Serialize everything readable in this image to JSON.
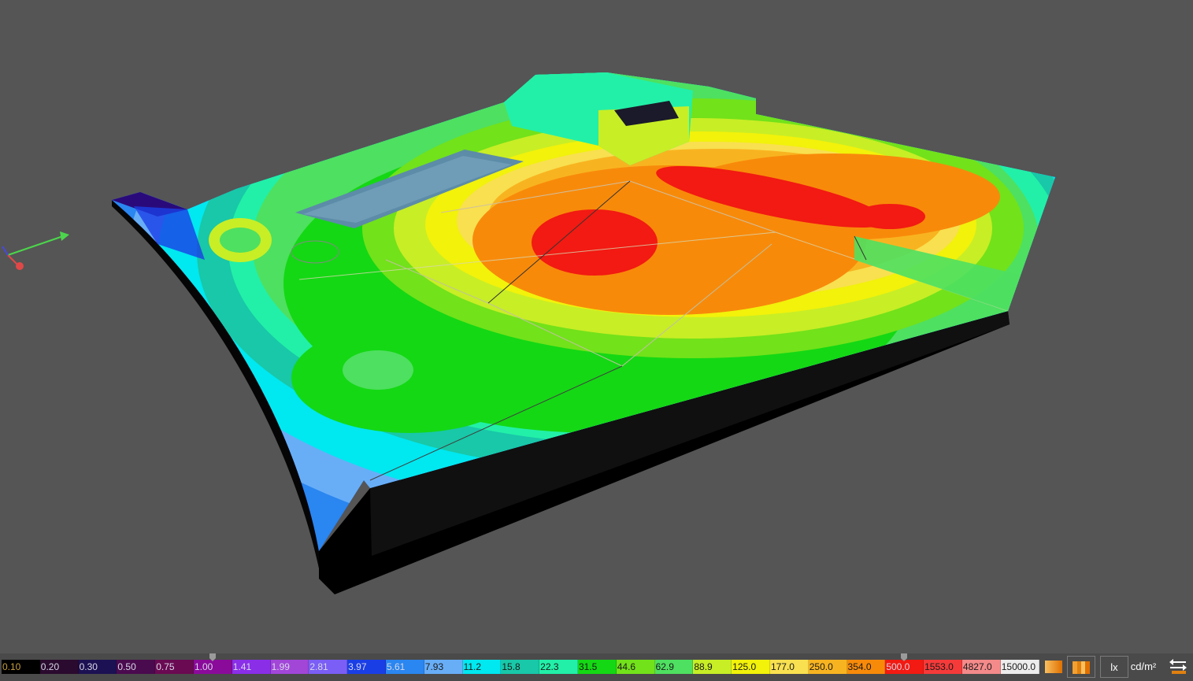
{
  "viewport": {
    "background": "#555555",
    "axes_gizmo": {
      "x_color": "#4cd64c",
      "y_color": "#e04848",
      "z_color": "#4848e0"
    }
  },
  "scale": {
    "levels": [
      {
        "label": "0.10",
        "color": "#000000"
      },
      {
        "label": "0.20",
        "color": "#2a0a2e"
      },
      {
        "label": "0.30",
        "color": "#1c1152"
      },
      {
        "label": "0.50",
        "color": "#4a0a4e"
      },
      {
        "label": "0.75",
        "color": "#6a0a52"
      },
      {
        "label": "1.00",
        "color": "#8a0a9a"
      },
      {
        "label": "1.41",
        "color": "#8a2ee8"
      },
      {
        "label": "1.99",
        "color": "#a246d8"
      },
      {
        "label": "2.81",
        "color": "#7a5ef5"
      },
      {
        "label": "3.97",
        "color": "#1a3ee6"
      },
      {
        "label": "5.61",
        "color": "#2a86f0"
      },
      {
        "label": "7.93",
        "color": "#68aef7"
      },
      {
        "label": "11.2",
        "color": "#00e8f0"
      },
      {
        "label": "15.8",
        "color": "#18c8a8"
      },
      {
        "label": "22.3",
        "color": "#22f0a8"
      },
      {
        "label": "31.5",
        "color": "#14d814"
      },
      {
        "label": "44.6",
        "color": "#72e21a"
      },
      {
        "label": "62.9",
        "color": "#4ee060"
      },
      {
        "label": "88.9",
        "color": "#c8ee26"
      },
      {
        "label": "125.0",
        "color": "#f2f20a"
      },
      {
        "label": "177.0",
        "color": "#f8e050"
      },
      {
        "label": "250.0",
        "color": "#f8b420"
      },
      {
        "label": "354.0",
        "color": "#f88a0a"
      },
      {
        "label": "500.0",
        "color": "#f21a12"
      },
      {
        "label": "1553.0",
        "color": "#f63a3a"
      },
      {
        "label": "4827.0",
        "color": "#f48a8a"
      },
      {
        "label": "15000.0",
        "color": "#ececec"
      }
    ],
    "range_low_index": 5,
    "range_high_index": 23
  },
  "controls": {
    "unit_lux": "lx",
    "unit_luminance": "cd/m²",
    "gradient_smooth_icon": "gradient-smooth-icon",
    "gradient_stepped_icon": "gradient-stepped-icon",
    "swap_icon": "swap-arrows-icon"
  }
}
